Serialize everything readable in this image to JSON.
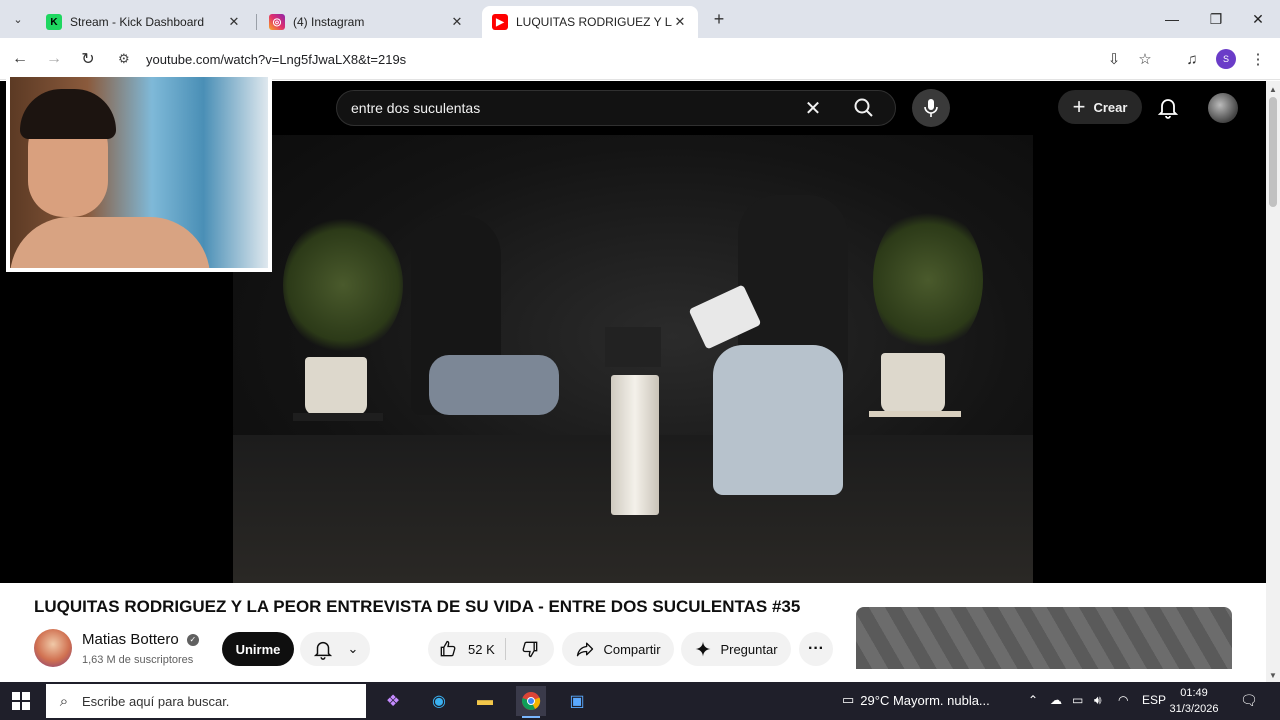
{
  "browser": {
    "tabs": [
      {
        "title": "Stream - Kick Dashboard",
        "icon": "kick-icon",
        "color": "#1ed760",
        "active": false
      },
      {
        "title": "(4) Instagram",
        "icon": "instagram-icon",
        "color": "#e1306c",
        "active": false
      },
      {
        "title": "LUQUITAS RODRIGUEZ Y LA PE",
        "icon": "youtube-icon",
        "color": "#ff0000",
        "active": true
      }
    ],
    "url": "youtube.com/watch?v=Lng5fJwaLX8&t=219s",
    "profile_initial": "S"
  },
  "youtube": {
    "search_query": "entre dos suculentas",
    "create_label": "Crear",
    "video_title": "LUQUITAS RODRIGUEZ Y LA PEOR ENTREVISTA DE SU VIDA - ENTRE DOS SUCULENTAS #35",
    "channel_name": "Matias Bottero",
    "subscribers": "1,63 M de suscriptores",
    "join_label": "Unirme",
    "likes": "52 K",
    "share_label": "Compartir",
    "ask_label": "Preguntar",
    "more_label": "···"
  },
  "taskbar": {
    "search_placeholder": "Escribe aquí para buscar.",
    "weather": "29°C  Mayorm. nubla...",
    "language": "ESP",
    "time": "01:49",
    "date": "31/3/2026"
  }
}
